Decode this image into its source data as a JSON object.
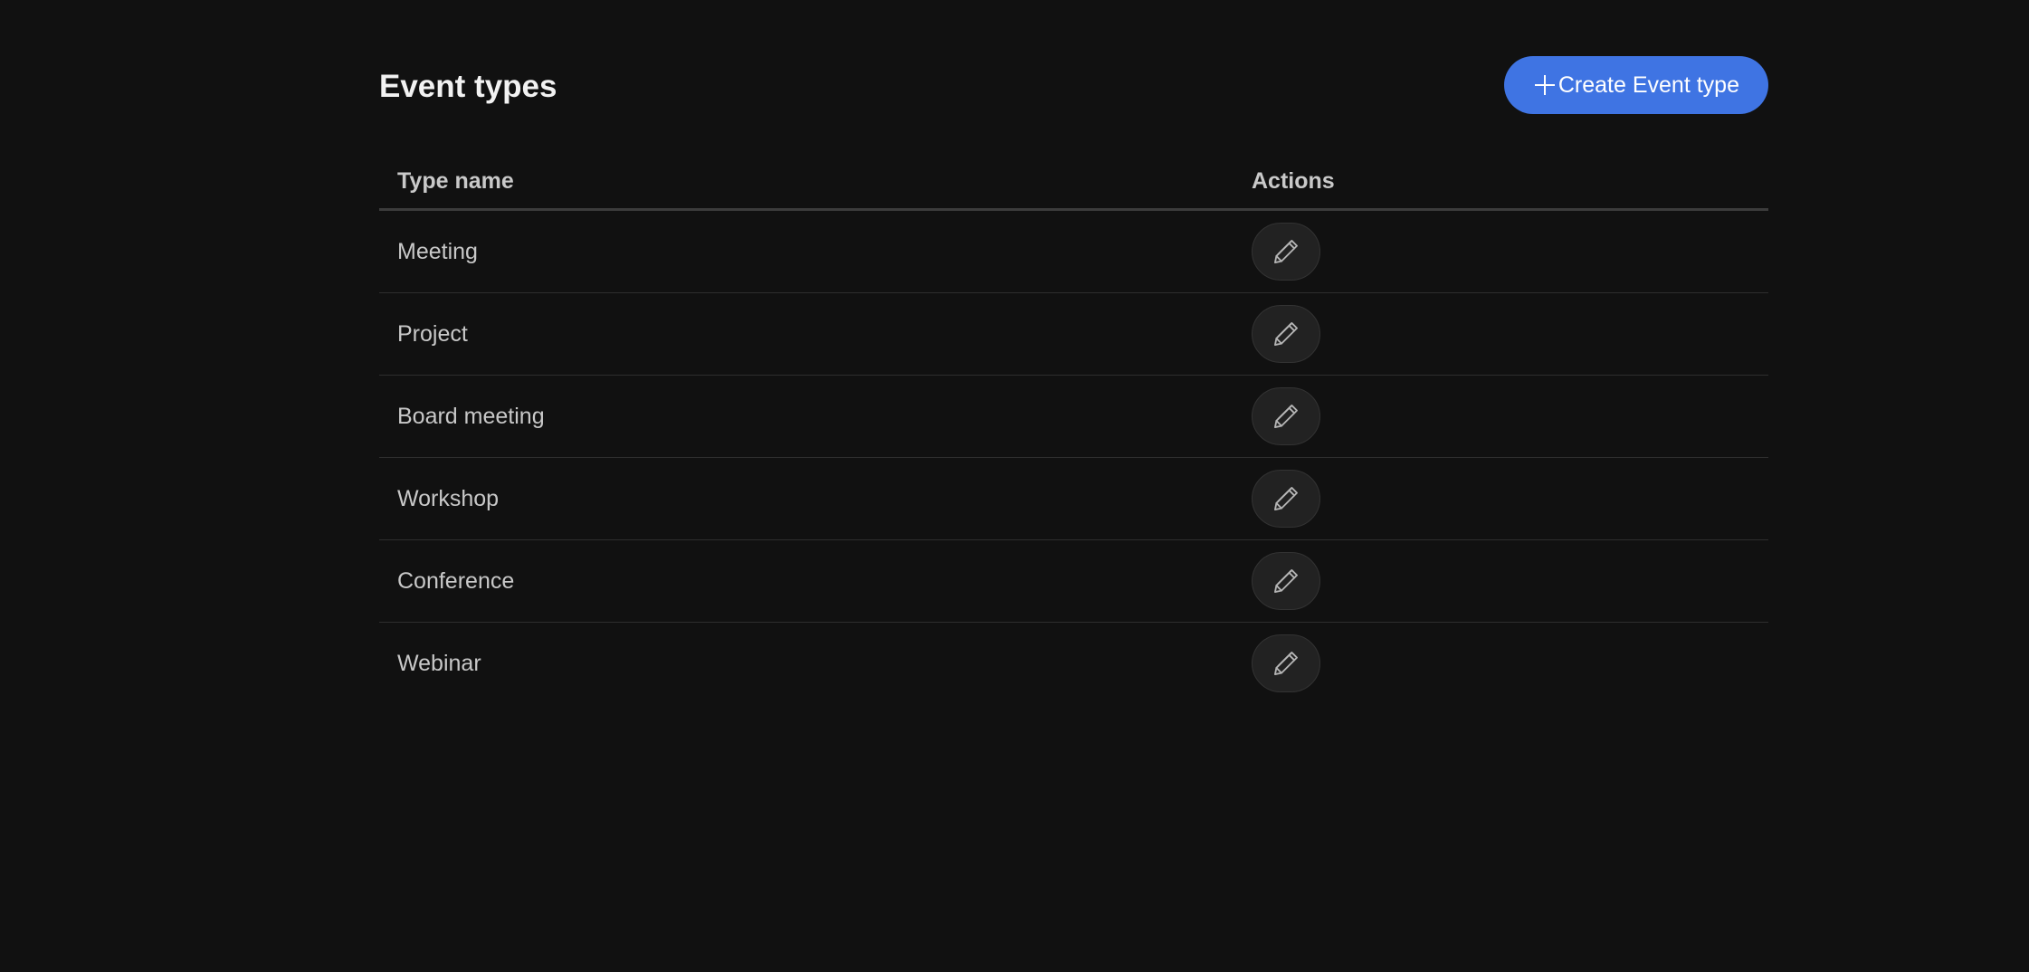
{
  "header": {
    "title": "Event types",
    "create_button_label": "Create Event type",
    "create_button_icon": "plus-icon"
  },
  "table": {
    "columns": [
      "Type name",
      "Actions"
    ],
    "rows": [
      {
        "name": "Meeting",
        "action_icon": "pencil-icon"
      },
      {
        "name": "Project",
        "action_icon": "pencil-icon"
      },
      {
        "name": "Board meeting",
        "action_icon": "pencil-icon"
      },
      {
        "name": "Workshop",
        "action_icon": "pencil-icon"
      },
      {
        "name": "Conference",
        "action_icon": "pencil-icon"
      },
      {
        "name": "Webinar",
        "action_icon": "pencil-icon"
      }
    ]
  },
  "colors": {
    "background": "#111111",
    "accent": "#3f74e3",
    "edit_button_bg": "#222222"
  }
}
